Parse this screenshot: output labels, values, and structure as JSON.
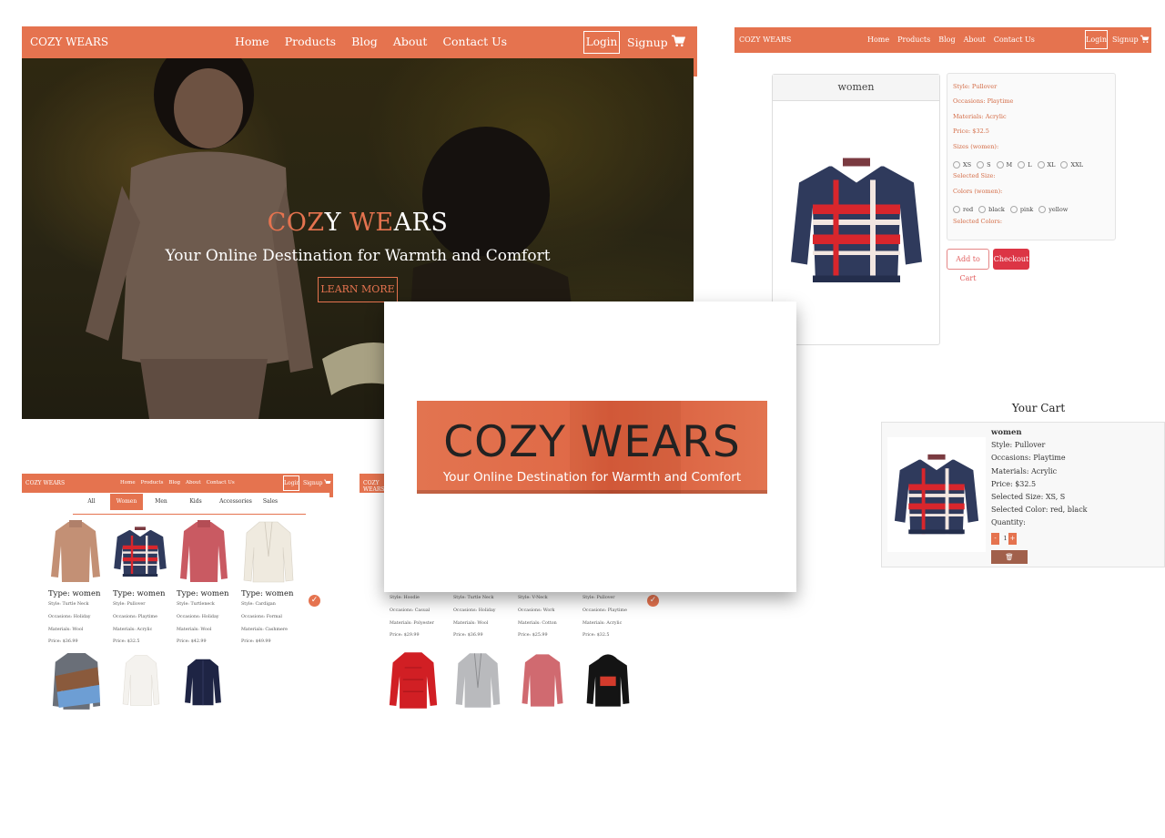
{
  "brand": "COZY WEARS",
  "nav_links": [
    "Home",
    "Products",
    "Blog",
    "About",
    "Contact Us"
  ],
  "login_label": "Login",
  "signup_label": "Signup",
  "hero": {
    "title_part1": "COZ",
    "title_part2": "Y ",
    "title_part3": "WE",
    "title_part4": "ARS",
    "subtitle": "Your Online Destination for Warmth and Comfort",
    "button": "LEARN MORE"
  },
  "logo": {
    "title": "COZY WEARS",
    "tagline": "Your Online Destination for Warmth and Comfort"
  },
  "product_detail": {
    "header": "women",
    "style": "Style: Pullover",
    "occasions": "Occasions: Playtime",
    "materials": "Materials: Acrylic",
    "price": "Price: $32.5",
    "sizes_label": "Sizes (women):",
    "sizes": [
      "XS",
      "S",
      "M",
      "L",
      "XL",
      "XXL"
    ],
    "selected_size": "Selected Size:",
    "colors_label": "Colors (women):",
    "colors": [
      "red",
      "black",
      "pink",
      "yellow"
    ],
    "selected_colors": "Selected Colors:",
    "add_to_cart": "Add to Cart",
    "checkout": "Checkout"
  },
  "cart": {
    "title": "Your Cart",
    "item_name": "women",
    "style": "Style: Pullover",
    "occasions": "Occasions: Playtime",
    "materials": "Materials: Acrylic",
    "price": "Price: $32.5",
    "selected_size": "Selected Size: XS, S",
    "selected_color": "Selected Color: red, black",
    "quantity_label": "Quantity:",
    "minus": "-",
    "quantity": "1",
    "plus": "+",
    "remove": "Remove"
  },
  "catalog": {
    "tabs": [
      "All",
      "Women",
      "Men",
      "Kids",
      "Accessories",
      "Sales"
    ],
    "active_tab": "Women",
    "products": [
      {
        "type": "Type: women",
        "style": "Style: Turtle Neck",
        "occasions": "Occasions: Holiday",
        "materials": "Materials: Wool",
        "price": "Price: $36.99"
      },
      {
        "type": "Type: women",
        "style": "Style: Pullover",
        "occasions": "Occasions: Playtime",
        "materials": "Materials: Acrylic",
        "price": "Price: $32.5"
      },
      {
        "type": "Type: women",
        "style": "Style: Turtleneck",
        "occasions": "Occasions: Holiday",
        "materials": "Materials: Wool",
        "price": "Price: $42.99"
      },
      {
        "type": "Type: women",
        "style": "Style: Cardigan",
        "occasions": "Occasions: Formal",
        "materials": "Materials: Cashmere",
        "price": "Price: $49.99"
      }
    ]
  },
  "catalog2": {
    "products": [
      {
        "style": "Style: Hoodie",
        "occasions": "Occasions: Casual",
        "materials": "Materials: Polyester",
        "price": "Price: $29.99"
      },
      {
        "style": "Style: Turtle Neck",
        "occasions": "Occasions: Holiday",
        "materials": "Materials: Wool",
        "price": "Price: $36.99"
      },
      {
        "style": "Style: V-Neck",
        "occasions": "Occasions: Work",
        "materials": "Materials: Cotton",
        "price": "Price: $25.99"
      },
      {
        "style": "Style: Pullover",
        "occasions": "Occasions: Playtime",
        "materials": "Materials: Acrylic",
        "price": "Price: $32.5"
      }
    ]
  },
  "colors": {
    "brand_orange": "#e5734f",
    "checkout_red": "#dc3545",
    "remove_brown": "#a1604b"
  },
  "icons": [
    "cart-icon",
    "check-icon",
    "trash-icon"
  ]
}
